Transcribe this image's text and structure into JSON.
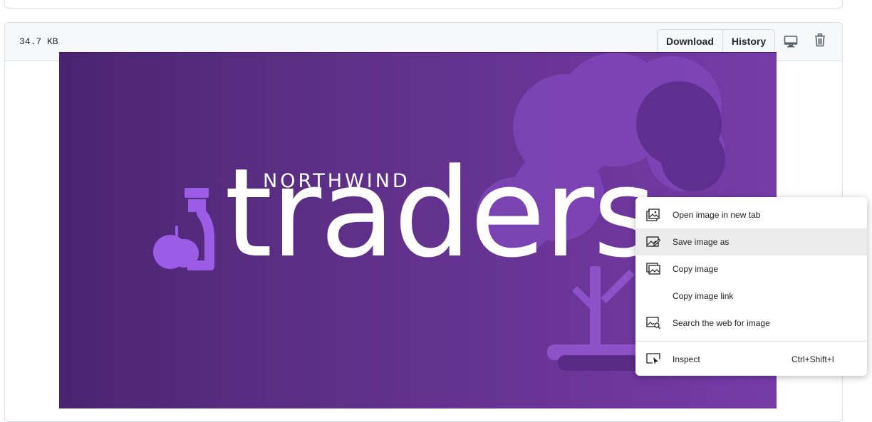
{
  "file": {
    "size": "34.7 KB",
    "download_label": "Download",
    "history_label": "History"
  },
  "image": {
    "brand_top": "NORTHWIND",
    "brand_main": "traders",
    "colors": {
      "bg_dark": "#4a2470",
      "bg_light": "#753ca8",
      "accent": "#9b5de5"
    }
  },
  "context_menu": {
    "items": [
      {
        "label": "Open image in new tab",
        "icon": "open-image-icon"
      },
      {
        "label": "Save image as",
        "icon": "save-image-icon",
        "highlighted": true
      },
      {
        "label": "Copy image",
        "icon": "copy-image-icon"
      },
      {
        "label": "Copy image link",
        "icon": ""
      },
      {
        "label": "Search the web for image",
        "icon": "search-image-icon"
      }
    ],
    "inspect": {
      "label": "Inspect",
      "shortcut": "Ctrl+Shift+I",
      "icon": "inspect-icon"
    }
  }
}
